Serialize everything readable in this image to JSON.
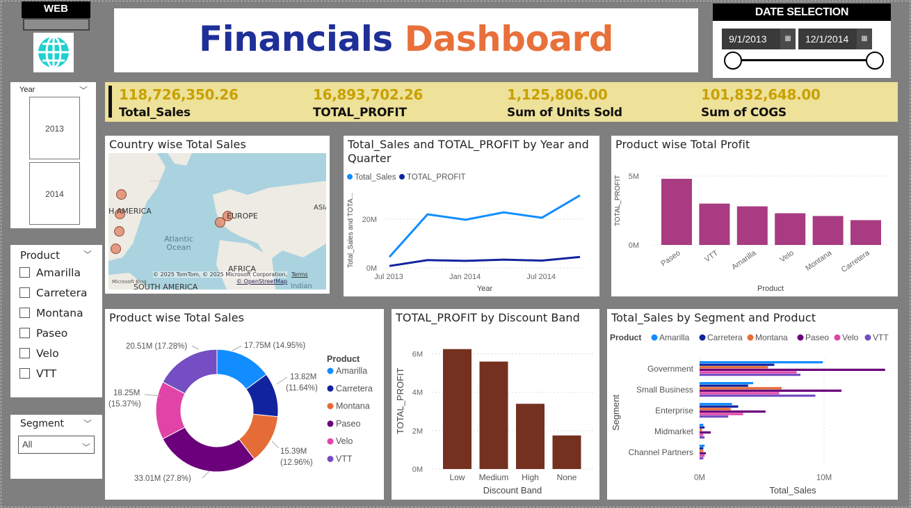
{
  "web": {
    "label": "WEB",
    "icon": "globe-icon"
  },
  "title": {
    "part1": "Financials",
    "part2": "Dashboard",
    "color1": "#1e2f97",
    "color2": "#e8703a"
  },
  "date_selection": {
    "title": "DATE SELECTION",
    "start": "9/1/2013",
    "end": "12/1/2014",
    "range_fraction": [
      0,
      1
    ]
  },
  "kpis": [
    {
      "value": "118,726,350.26",
      "label": "Total_Sales"
    },
    {
      "value": "16,893,702.26",
      "label": "TOTAL_PROFIT"
    },
    {
      "value": "1,125,806.00",
      "label": "Sum of Units Sold"
    },
    {
      "value": "101,832,648.00",
      "label": "Sum of COGS"
    }
  ],
  "year_slicer": {
    "title": "Year",
    "items": [
      "2013",
      "2014"
    ]
  },
  "product_slicer": {
    "title": "Product",
    "items": [
      "Amarilla",
      "Carretera",
      "Montana",
      "Paseo",
      "Velo",
      "VTT"
    ]
  },
  "segment_slicer": {
    "title": "Segment",
    "value": "All"
  },
  "map": {
    "title": "Country wise Total Sales",
    "labels": {
      "na": "H AMERICA",
      "europe": "EUROPE",
      "asia": "ASIA",
      "ocean": "Atlantic Ocean",
      "africa": "AFRICA",
      "sa": "SOUTH AMERICA",
      "indian": "Indian"
    },
    "credits": "© 2025 TomTom, © 2025 Microsoft Corporation,",
    "terms": "Terms",
    "osm": "© OpenStreetMap",
    "bing": "Microsoft Bing"
  },
  "chart_data": [
    {
      "type": "line",
      "title": "Total_Sales and TOTAL_PROFIT by Year and Quarter",
      "xlabel": "Year",
      "ylabel": "Total_Sales and TOTA...",
      "x": [
        "2013 Q3",
        "2013 Q4",
        "2014 Q1",
        "2014 Q2",
        "2014 Q3",
        "2014 Q4"
      ],
      "x_ticks": [
        "Jul 2013",
        "Jan 2014",
        "Jul 2014"
      ],
      "y_ticks": [
        "0M",
        "20M"
      ],
      "ylim": [
        0,
        32
      ],
      "legend": "top-left",
      "series": [
        {
          "name": "Total_Sales",
          "color": "#118dff",
          "values": [
            4.5,
            22,
            19.8,
            22.8,
            20.6,
            29.8
          ]
        },
        {
          "name": "TOTAL_PROFIT",
          "color": "#12239e",
          "values": [
            0.8,
            3.2,
            2.9,
            3.4,
            3.0,
            4.5
          ]
        }
      ]
    },
    {
      "type": "bar",
      "title": "Product wise Total Profit",
      "xlabel": "Product",
      "ylabel": "TOTAL_PROFIT",
      "categories": [
        "Paseo",
        "VTT",
        "Amarilla",
        "Velo",
        "Montana",
        "Carretera"
      ],
      "values": [
        4.8,
        3.0,
        2.8,
        2.3,
        2.1,
        1.8
      ],
      "y_ticks": [
        "0M",
        "5M"
      ],
      "ylim": [
        0,
        5.2
      ],
      "color": "#a83b81"
    },
    {
      "type": "pie",
      "title": "Product wise Total Sales",
      "legend_title": "Product",
      "categories": [
        "Amarilla",
        "Carretera",
        "Montana",
        "Paseo",
        "Velo",
        "VTT"
      ],
      "values": [
        17.75,
        13.82,
        15.39,
        33.01,
        18.25,
        20.51
      ],
      "labels": [
        "17.75M (14.95%)",
        "13.82M (11.64%)",
        "15.39M (12.96%)",
        "33.01M (27.8%)",
        "18.25M (15.37%)",
        "20.51M (17.28%)"
      ],
      "colors": [
        "#118dff",
        "#12239e",
        "#e66c37",
        "#6b007b",
        "#e044a7",
        "#744ec2"
      ]
    },
    {
      "type": "bar",
      "title": "TOTAL_PROFIT by Discount Band",
      "xlabel": "Discount Band",
      "ylabel": "TOTAL_PROFIT",
      "categories": [
        "Low",
        "Medium",
        "High",
        "None"
      ],
      "values": [
        6.25,
        5.6,
        3.4,
        1.75
      ],
      "y_ticks": [
        "0M",
        "2M",
        "4M",
        "6M"
      ],
      "ylim": [
        0,
        6.6
      ],
      "color": "#75311f"
    },
    {
      "type": "bar",
      "orientation": "horizontal",
      "title": "Total_Sales by Segment and Product",
      "legend_title": "Product",
      "xlabel": "Total_Sales",
      "ylabel": "Segment",
      "categories": [
        "Government",
        "Small Business",
        "Enterprise",
        "Midmarket",
        "Channel Partners"
      ],
      "x_ticks": [
        "0M",
        "10M"
      ],
      "xlim": [
        0,
        15.5
      ],
      "series": [
        {
          "name": "Amarilla",
          "color": "#118dff",
          "values": [
            9.9,
            4.3,
            2.6,
            0.3,
            0.4
          ]
        },
        {
          "name": "Carretera",
          "color": "#12239e",
          "values": [
            6.0,
            3.9,
            3.1,
            0.4,
            0.3
          ]
        },
        {
          "name": "Montana",
          "color": "#e66c37",
          "values": [
            5.5,
            6.6,
            2.5,
            0.2,
            0.3
          ]
        },
        {
          "name": "Paseo",
          "color": "#6b007b",
          "values": [
            14.9,
            11.4,
            5.3,
            0.9,
            0.5
          ]
        },
        {
          "name": "Velo",
          "color": "#e044a7",
          "values": [
            7.8,
            6.4,
            3.5,
            0.3,
            0.4
          ]
        },
        {
          "name": "VTT",
          "color": "#744ec2",
          "values": [
            8.1,
            9.3,
            2.3,
            0.4,
            0.3
          ]
        }
      ]
    }
  ]
}
